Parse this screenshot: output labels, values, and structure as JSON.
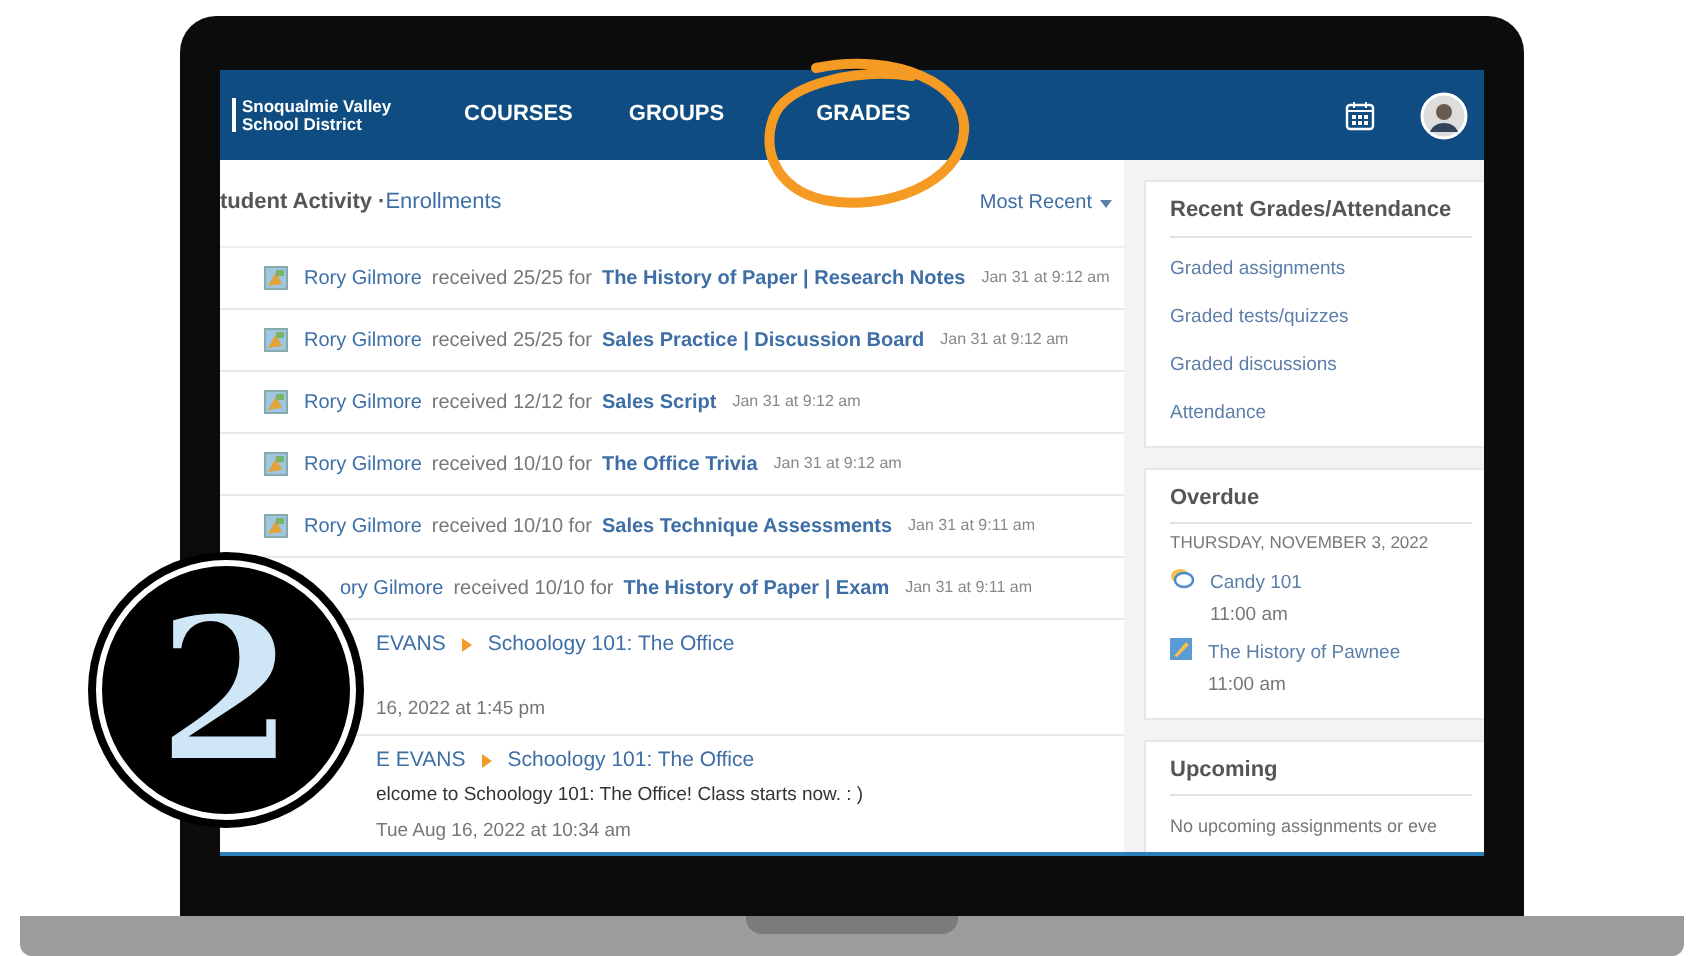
{
  "step_badge": "2",
  "navbar": {
    "logo_lines": [
      "Snoqualmie Valley",
      "School District"
    ],
    "items": [
      {
        "label": "COURSES"
      },
      {
        "label": "GROUPS"
      },
      {
        "label": "GRADES"
      }
    ]
  },
  "activity": {
    "title": "tudent Activity ·",
    "link": "Enrollments",
    "sort": "Most Recent",
    "rows": [
      {
        "kind": "grade",
        "icon": true,
        "student": "Rory Gilmore",
        "text": "received 25/25 for",
        "item": "The History of Paper | Research Notes",
        "time": "Jan 31 at 9:12 am"
      },
      {
        "kind": "grade",
        "icon": true,
        "student": "Rory Gilmore",
        "text": "received 25/25 for",
        "item": "Sales Practice | Discussion Board",
        "time": "Jan 31 at 9:12 am"
      },
      {
        "kind": "grade",
        "icon": true,
        "student": "Rory Gilmore",
        "text": "received 12/12 for",
        "item": "Sales Script",
        "time": "Jan 31 at 9:12 am"
      },
      {
        "kind": "grade",
        "icon": true,
        "student": "Rory Gilmore",
        "text": "received 10/10 for",
        "item": "The Office Trivia",
        "time": "Jan 31 at 9:12 am"
      },
      {
        "kind": "grade",
        "icon": true,
        "student": "Rory Gilmore",
        "text": "received 10/10 for",
        "item": "Sales Technique Assessments",
        "time": "Jan 31 at 9:11 am"
      },
      {
        "kind": "grade",
        "icon": false,
        "student": "ory Gilmore",
        "text": "received 10/10 for",
        "item": "The History of Paper | Exam",
        "time": "Jan 31 at 9:11 am"
      },
      {
        "kind": "post",
        "author": "EVANS",
        "course": "Schoology 101: The Office",
        "time": "16, 2022 at 1:45 pm"
      },
      {
        "kind": "post",
        "author": "E EVANS",
        "course": "Schoology 101: The Office",
        "message": "elcome to Schoology 101: The Office!  Class starts now. : )",
        "time": "Tue Aug 16, 2022 at 10:34 am"
      }
    ]
  },
  "sidebar": [
    {
      "kind": "links",
      "title": "Recent Grades/Attendance",
      "links": [
        "Graded assignments",
        "Graded tests/quizzes",
        "Graded discussions",
        "Attendance"
      ]
    },
    {
      "kind": "overdue",
      "title": "Overdue",
      "date": "THURSDAY, NOVEMBER 3, 2022",
      "items": [
        {
          "kind": "discussion",
          "title": "Candy 101",
          "time": "11:00 am"
        },
        {
          "kind": "assignment",
          "title": "The History of Pawnee",
          "time": "11:00 am"
        }
      ]
    },
    {
      "kind": "empty",
      "title": "Upcoming",
      "text": "No upcoming assignments or eve"
    }
  ]
}
